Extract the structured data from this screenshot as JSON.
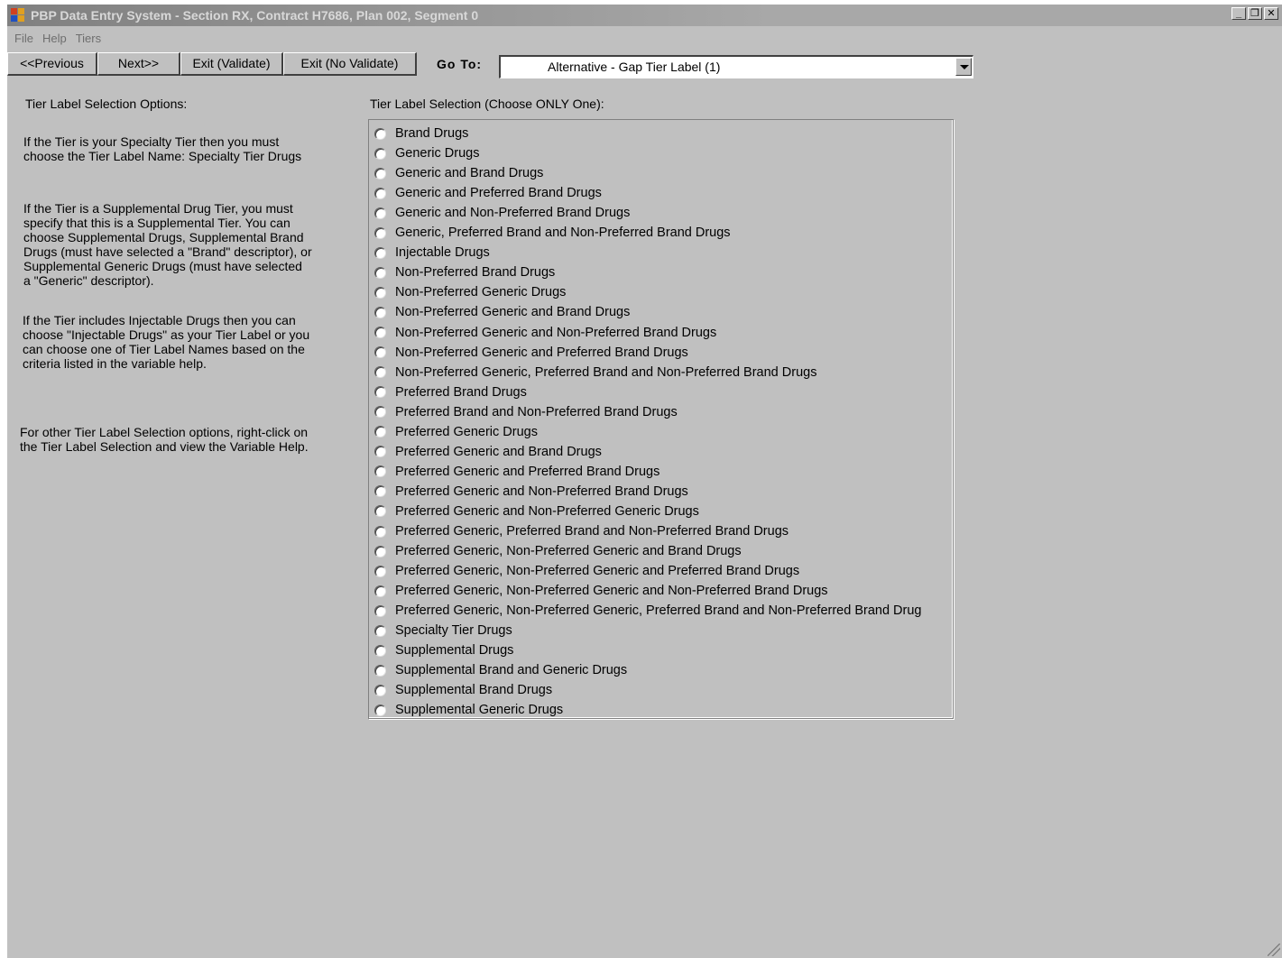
{
  "window": {
    "title": "PBP Data Entry System - Section RX, Contract H7686, Plan 002, Segment 0",
    "controls": [
      "minimize",
      "restore",
      "close"
    ]
  },
  "menu": [
    "File",
    "Help",
    "Tiers"
  ],
  "toolbar": {
    "previous": "<<Previous",
    "next": "Next>>",
    "exit_validate": "Exit (Validate)",
    "exit_no_validate": "Exit (No Validate)",
    "goto_label": "Go To:",
    "goto_value": "Alternative - Gap Tier Label (1)"
  },
  "left": {
    "heading": "Tier Label Selection Options:",
    "para1": "If the Tier is your Specialty Tier then you must\nchoose the Tier Label Name: Specialty Tier Drugs",
    "para2": "If the Tier is a Supplemental Drug Tier, you must\nspecify that this is a Supplemental Tier. You can\nchoose Supplemental Drugs, Supplemental Brand\nDrugs (must have selected a \"Brand\" descriptor), or\nSupplemental Generic Drugs (must have selected\na \"Generic\" descriptor).",
    "para3": "If the Tier includes Injectable Drugs then you can\nchoose \"Injectable Drugs\" as your Tier Label or you\ncan choose one of Tier Label Names based on the\ncriteria listed in the variable help.",
    "para4": "For other Tier Label Selection options, right-click on\nthe Tier Label Selection and view the Variable Help."
  },
  "selection": {
    "heading": "Tier Label Selection (Choose ONLY One):",
    "options": [
      "Brand Drugs",
      "Generic Drugs",
      "Generic and Brand Drugs",
      "Generic and Preferred Brand Drugs",
      "Generic and Non-Preferred Brand Drugs",
      "Generic, Preferred Brand and Non-Preferred Brand Drugs",
      "Injectable Drugs",
      "Non-Preferred Brand Drugs",
      "Non-Preferred Generic Drugs",
      "Non-Preferred Generic and Brand Drugs",
      "Non-Preferred Generic and Non-Preferred Brand Drugs",
      "Non-Preferred Generic and Preferred Brand Drugs",
      "Non-Preferred Generic, Preferred Brand and Non-Preferred Brand Drugs",
      "Preferred Brand Drugs",
      "Preferred Brand and Non-Preferred Brand Drugs",
      "Preferred Generic Drugs",
      "Preferred Generic and Brand Drugs",
      "Preferred Generic and Preferred Brand Drugs",
      "Preferred Generic and Non-Preferred Brand Drugs",
      "Preferred Generic and Non-Preferred Generic Drugs",
      "Preferred Generic, Preferred Brand and Non-Preferred Brand Drugs",
      "Preferred Generic, Non-Preferred Generic and Brand Drugs",
      "Preferred Generic, Non-Preferred Generic and Preferred Brand Drugs",
      "Preferred Generic, Non-Preferred Generic and Non-Preferred Brand Drugs",
      "Preferred  Generic,  Non-Preferred  Generic,  Preferred  Brand  and  Non-Preferred  Brand Drug",
      "Specialty Tier Drugs",
      "Supplemental Drugs",
      "Supplemental Brand and Generic Drugs",
      "Supplemental Brand Drugs",
      "Supplemental Generic Drugs"
    ]
  }
}
